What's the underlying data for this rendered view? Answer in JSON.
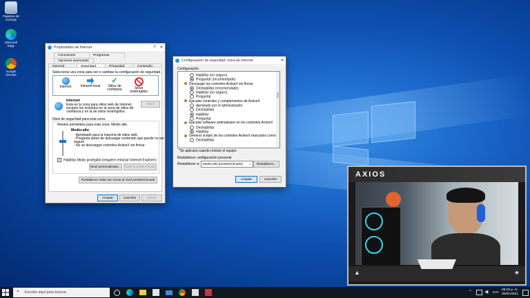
{
  "desktop": {
    "icons": [
      {
        "label": "Papelera de reciclaje",
        "name": "recycle-bin-icon"
      },
      {
        "label": "Microsoft Edge",
        "name": "edge-icon"
      },
      {
        "label": "Google Chrome",
        "name": "chrome-icon"
      }
    ]
  },
  "props_window": {
    "title": "Propiedades de Internet",
    "tabs_row1": [
      "Conexiones",
      "Programas",
      "Opciones avanzadas"
    ],
    "tabs_row2": [
      "General",
      "Seguridad",
      "Privacidad",
      "Contenido"
    ],
    "active_tab": "Seguridad",
    "zone_prompt": "Seleccione una zona para ver o cambiar la configuración de seguridad.",
    "zones": [
      {
        "label": "Internet",
        "icon": "globe-icon"
      },
      {
        "label": "Intranet local",
        "icon": "intranet-icon"
      },
      {
        "label": "Sitios de confianza",
        "icon": "check-icon"
      },
      {
        "label": "Sitios restringidos",
        "icon": "restricted-icon"
      }
    ],
    "zone_title": "Internet",
    "zone_desc": [
      "Esta es la zona para sitios web de Internet,",
      "excepto los incluidos en la zona de sitios de",
      "confianza y en la de sitios restringidos."
    ],
    "sites_button": "Sitios",
    "level_group": "Nivel de seguridad para esta zona",
    "levels_allowed": "Niveles permitidos para esta zona: Medio alto",
    "level_name": "Medio-alto",
    "level_points": [
      "- Apropiado para la mayoría de sitios web",
      "- Pregunta antes de descargar contenido que puede no ser",
      "  seguro",
      "- No se descargan controles ActiveX sin firmar"
    ],
    "protected_mode": "Habilitar Modo protegido (requiere reiniciar Internet Explorer)",
    "custom_level_button": "Nivel personalizado...",
    "default_level_button": "Nivel predeterminado",
    "reset_all_button": "Restablecer todas las zonas al nivel predeterminado",
    "ok": "Aceptar",
    "cancel": "Cancelar",
    "apply": "Aplicar"
  },
  "sec_window": {
    "title": "Configuración de seguridad: zona de Internet",
    "config_label": "Configuración",
    "items": [
      {
        "type": "radio",
        "label": "Habilitar (no seguro)",
        "on": false
      },
      {
        "type": "radio",
        "label": "Preguntar (recomendado)",
        "on": true
      },
      {
        "type": "head",
        "label": "Descargar los controles ActiveX sin firmar"
      },
      {
        "type": "radio",
        "label": "Deshabilitar (recomendado)",
        "on": true
      },
      {
        "type": "radio",
        "label": "Habilitar (no seguro)",
        "on": false
      },
      {
        "type": "radio",
        "label": "Preguntar",
        "on": false
      },
      {
        "type": "head",
        "label": "Ejecutar controles y complementos de ActiveX"
      },
      {
        "type": "radio",
        "label": "Aprobado por el administrador",
        "on": false
      },
      {
        "type": "radio",
        "label": "Deshabilitar",
        "on": false
      },
      {
        "type": "radio",
        "label": "Habilitar",
        "on": true
      },
      {
        "type": "radio",
        "label": "Preguntar",
        "on": false
      },
      {
        "type": "head",
        "label": "Ejecutar software antimalware en los controles ActiveX"
      },
      {
        "type": "radio",
        "label": "Deshabilitar",
        "on": false
      },
      {
        "type": "radio",
        "label": "Habilitar",
        "on": true
      },
      {
        "type": "head",
        "label": "Generar scripts de los controles ActiveX marcados como seg..."
      },
      {
        "type": "radio",
        "label": "Deshabilitar",
        "on": false
      }
    ],
    "restart_note": "*Se aplicará cuando reinicie el equipo",
    "reset_group": "Restablecer configuración personal",
    "reset_to": "Restablecer a:",
    "reset_value": "Medio-alto (predeterminado)",
    "reset_button": "Restablecer...",
    "ok": "Aceptar",
    "cancel": "Cancelar"
  },
  "taskbar": {
    "search_placeholder": "Escribe aquí para buscar.",
    "time": "08:29 p. m.",
    "date": "30/01/2021"
  },
  "overlay": {
    "brand": "AXIOS"
  }
}
